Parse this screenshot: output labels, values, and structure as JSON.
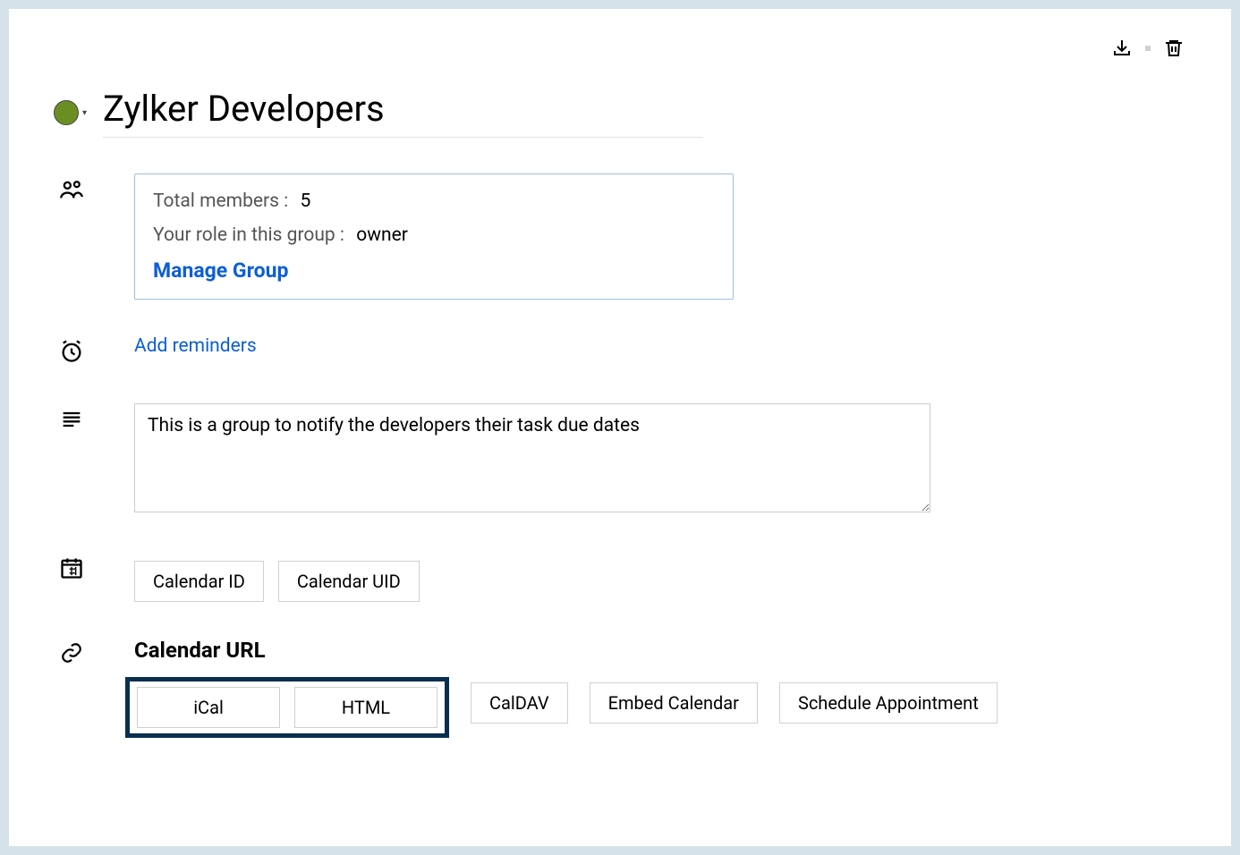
{
  "header": {
    "title": "Zylker Developers",
    "indicator_color": "#6b8e23"
  },
  "group": {
    "members_label": "Total members :",
    "members_value": "5",
    "role_label": "Your role in this group :",
    "role_value": "owner",
    "manage_label": "Manage Group"
  },
  "reminders": {
    "link_label": "Add reminders"
  },
  "description": {
    "value": "This is a group to notify the developers their task due dates"
  },
  "calendar_ids": {
    "btn_id": "Calendar ID",
    "btn_uid": "Calendar UID"
  },
  "calendar_url": {
    "heading": "Calendar URL",
    "buttons": {
      "ical": "iCal",
      "html": "HTML",
      "caldav": "CalDAV",
      "embed": "Embed Calendar",
      "schedule": "Schedule Appointment"
    }
  },
  "icons": {
    "download": "download-icon",
    "trash": "trash-icon",
    "people": "people-icon",
    "clock": "alarm-icon",
    "description": "lines-icon",
    "calendar_hash": "calendar-hash-icon",
    "link": "link-icon",
    "chevron": "chevron-down-icon"
  }
}
